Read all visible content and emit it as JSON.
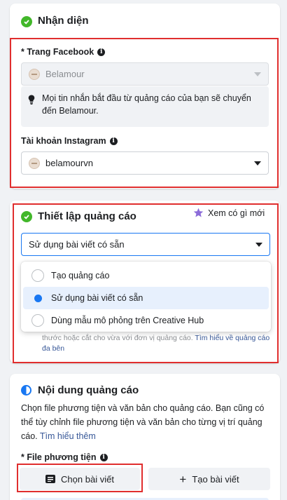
{
  "identity": {
    "title": "Nhận diện",
    "facebook_page_label": "* Trang Facebook",
    "facebook_page_value": "Belamour",
    "hint_text": "Mọi tin nhắn bắt đầu từ quảng cáo của bạn sẽ chuyển đến Belamour.",
    "instagram_label": "Tài khoản Instagram",
    "instagram_value": "belamourvn"
  },
  "ad_setup": {
    "title": "Thiết lập quảng cáo",
    "whats_new": "Xem có gì mới",
    "select_value": "Sử dụng bài viết có sẵn",
    "options": [
      {
        "label": "Tạo quảng cáo",
        "selected": false
      },
      {
        "label": "Sử dụng bài viết có sẵn",
        "selected": true
      },
      {
        "label": "Dùng mẫu mô phỏng trên Creative Hub",
        "selected": false
      }
    ],
    "behind_text": "thước hoặc cắt cho vừa với đơn vị quảng cáo.",
    "learn_more": "Tìm hiểu về quảng cáo đa bên"
  },
  "ad_content": {
    "title": "Nội dung quảng cáo",
    "description": "Chọn file phương tiện và văn bản cho quảng cáo. Bạn cũng có thể tùy chỉnh file phương tiện và văn bản cho từng vị trí quảng cáo.",
    "learn_more": "Tìm hiểu thêm",
    "media_label": "* File phương tiện",
    "choose_post_button": "Chọn bài viết",
    "create_post_button": "Tạo bài viết"
  },
  "colors": {
    "success": "#42b72a",
    "accent": "#1877f2",
    "highlight_border": "#e02e2e"
  }
}
